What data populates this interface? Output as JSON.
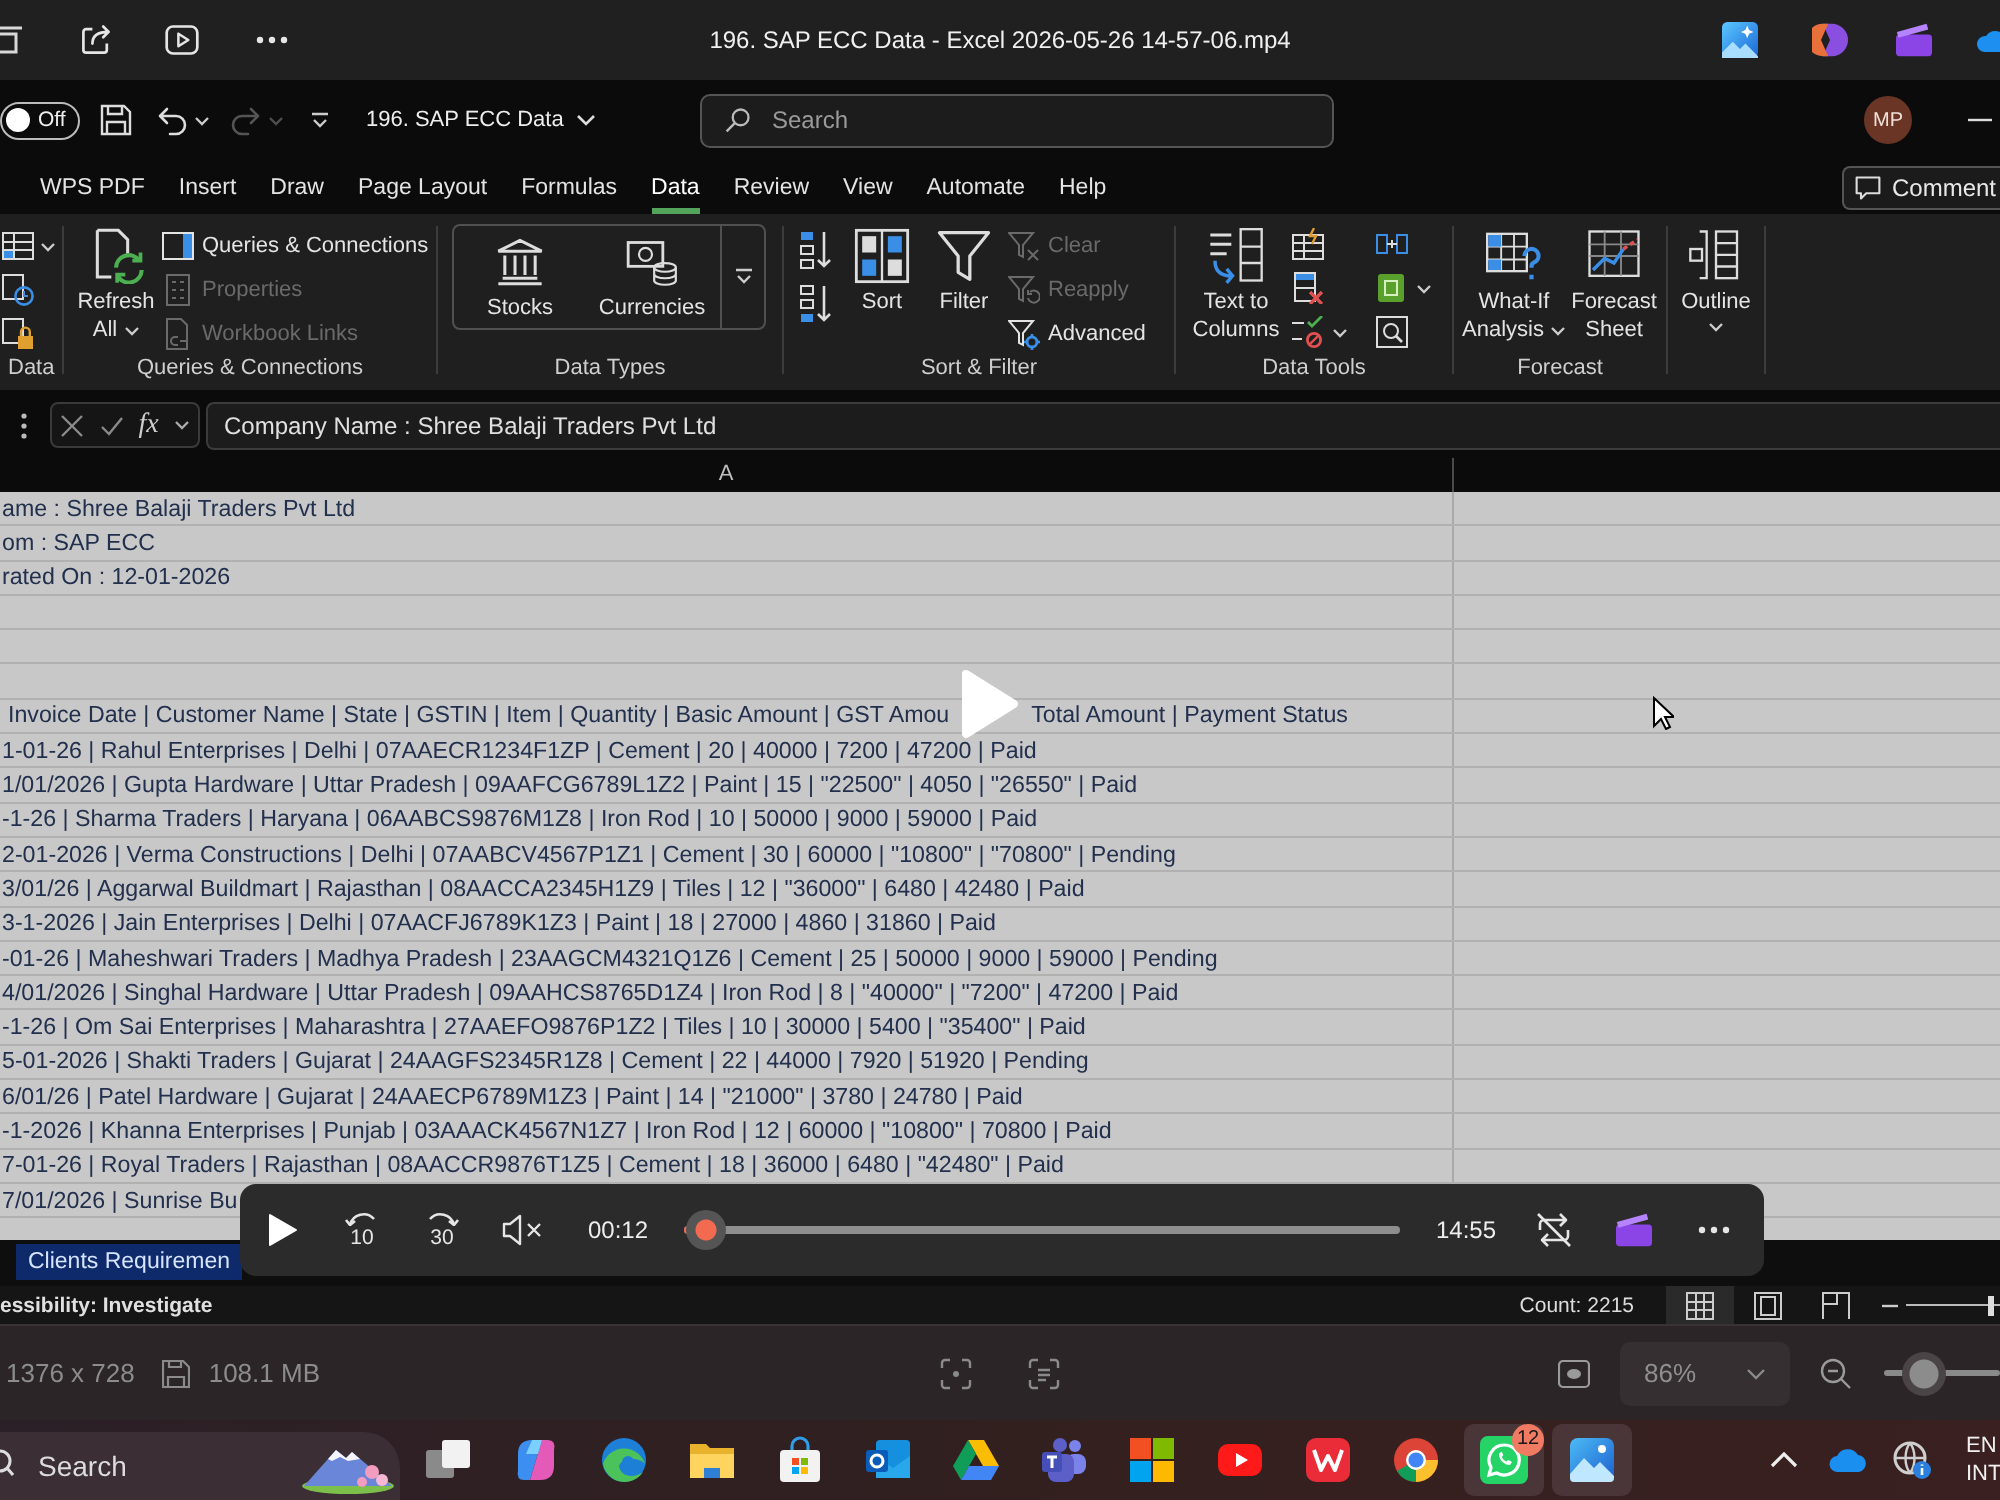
{
  "title_bar": {
    "title": "196. SAP ECC Data - Excel 2026-05-26 14-57-06.mp4"
  },
  "recording": {
    "quick_access": {
      "autosave": {
        "label": "Off",
        "on": false
      },
      "redo": {
        "disabled": true
      },
      "file_name": "196. SAP ECC Data",
      "search": {
        "placeholder": "Search"
      },
      "avatar": "MP"
    },
    "tabs": [
      {
        "label": "WPS PDF",
        "selected": false
      },
      {
        "label": "Insert",
        "selected": false
      },
      {
        "label": "Draw",
        "selected": false
      },
      {
        "label": "Page Layout",
        "selected": false
      },
      {
        "label": "Formulas",
        "selected": false
      },
      {
        "label": "Data",
        "selected": true
      },
      {
        "label": "Review",
        "selected": false
      },
      {
        "label": "View",
        "selected": false
      },
      {
        "label": "Automate",
        "selected": false
      },
      {
        "label": "Help",
        "selected": false
      }
    ],
    "comments_button": "Comment",
    "ribbon": {
      "get_data": {
        "group_label": "Data"
      },
      "queries": {
        "group_label": "Queries & Connections",
        "refresh_all": "Refresh All",
        "items": [
          {
            "label": "Queries & Connections",
            "disabled": false
          },
          {
            "label": "Properties",
            "disabled": true
          },
          {
            "label": "Workbook Links",
            "disabled": true
          }
        ]
      },
      "data_types": {
        "group_label": "Data Types",
        "items": [
          "Stocks",
          "Currencies"
        ]
      },
      "sort_filter": {
        "group_label": "Sort & Filter",
        "sort": "Sort",
        "filter": "Filter",
        "items": [
          {
            "label": "Clear",
            "disabled": true
          },
          {
            "label": "Reapply",
            "disabled": true
          },
          {
            "label": "Advanced",
            "disabled": false
          }
        ]
      },
      "data_tools": {
        "group_label": "Data Tools",
        "text_to_columns": "Text to Columns"
      },
      "forecast": {
        "group_label": "Forecast",
        "items": [
          "What-If Analysis",
          "Forecast Sheet"
        ]
      },
      "outline": {
        "label": "Outline"
      }
    },
    "formula_bar": {
      "function_label": "fx",
      "value": "Company Name : Shree Balaji Traders Pvt Ltd"
    },
    "sheet": {
      "column_header": "A",
      "info_lines": [
        "ame : Shree Balaji Traders Pvt Ltd",
        "om : SAP ECC",
        "rated On : 12-01-2026"
      ],
      "table_header": [
        "Invoice Date | Customer Name | State | GSTIN | Item | Quantity | Basic Amount | GST Amou",
        "Total Amount | Payment Status"
      ],
      "rows": [
        "1-01-26 | Rahul Enterprises | Delhi | 07AAECR1234F1ZP | Cement | 20 | 40000 | 7200 | 47200 | Paid",
        "1/01/2026 | Gupta Hardware | Uttar Pradesh | 09AAFCG6789L1Z2 | Paint | 15 | \"22500\" | 4050 | \"26550\" | Paid",
        "-1-26 | Sharma Traders | Haryana | 06AABCS9876M1Z8 | Iron Rod | 10 | 50000 | 9000 | 59000 | Paid",
        "2-01-2026 | Verma Constructions | Delhi | 07AABCV4567P1Z1 | Cement | 30 | 60000 | \"10800\" | \"70800\" | Pending",
        "3/01/26 | Aggarwal Buildmart | Rajasthan | 08AACCA2345H1Z9 | Tiles | 12 | \"36000\" | 6480 | 42480 | Paid",
        "3-1-2026 | Jain Enterprises | Delhi | 07AACFJ6789K1Z3 | Paint | 18 | 27000 | 4860 | 31860 | Paid",
        "-01-26 | Maheshwari Traders | Madhya Pradesh | 23AAGCM4321Q1Z6 | Cement | 25 | 50000 | 9000 | 59000 | Pending",
        "4/01/2026 | Singhal Hardware | Uttar Pradesh | 09AAHCS8765D1Z4 | Iron Rod | 8 | \"40000\" | \"7200\" | 47200 | Paid",
        "-1-26 | Om Sai Enterprises | Maharashtra | 27AAEFO9876P1Z2 | Tiles | 10 | 30000 | 5400 | \"35400\" | Paid",
        "5-01-2026 | Shakti Traders | Gujarat | 24AAGFS2345R1Z8 | Cement | 22 | 44000 | 7920 | 51920 | Pending",
        "6/01/26 | Patel Hardware | Gujarat | 24AAECP6789M1Z3 | Paint | 14 | \"21000\" | 3780 | 24780 | Paid",
        "-1-2026 | Khanna Enterprises | Punjab | 03AAACK4567N1Z7 | Iron Rod | 12 | 60000 | \"10800\" | 70800 | Paid",
        "7-01-26 | Royal Traders | Rajasthan | 08AACCR9876T1Z5 | Cement | 18 | 36000 | 6480 | \"42480\" | Paid",
        "7/01/2026 | Sunrise Bu"
      ]
    },
    "sheet_tabs": [
      {
        "label": "Clients Requiremen",
        "selected": true
      }
    ],
    "status_bar": {
      "accessibility": "essibility: Investigate",
      "count": "Count: 2215",
      "views": [
        {
          "selected": true
        },
        {
          "selected": false
        },
        {
          "selected": false
        }
      ],
      "zoom_slider": {
        "level": 0.9
      }
    }
  },
  "playback_controls": {
    "paused": true,
    "skip_back": "10",
    "skip_forward": "30",
    "muted": true,
    "current_time": "00:12",
    "progress": {
      "level": 0.03
    },
    "duration": "14:55",
    "repeat": false
  },
  "info_bar": {
    "dimensions": "1376 x 728",
    "file_size": "108.1 MB",
    "zoom": "86%",
    "zoom_slider": {
      "level": 0.34
    }
  },
  "taskbar": {
    "search": {
      "placeholder": "Search"
    },
    "apps": [
      {
        "selected": false
      },
      {
        "selected": false
      },
      {
        "selected": false
      },
      {
        "selected": false
      },
      {
        "selected": false
      },
      {
        "selected": false
      },
      {
        "selected": false
      },
      {
        "selected": false
      },
      {
        "selected": false
      },
      {
        "selected": false
      },
      {
        "selected": false
      },
      {
        "selected": false
      },
      {
        "selected": true,
        "badge": "12"
      },
      {
        "selected": true
      }
    ],
    "language": [
      "EN",
      "INT"
    ]
  }
}
